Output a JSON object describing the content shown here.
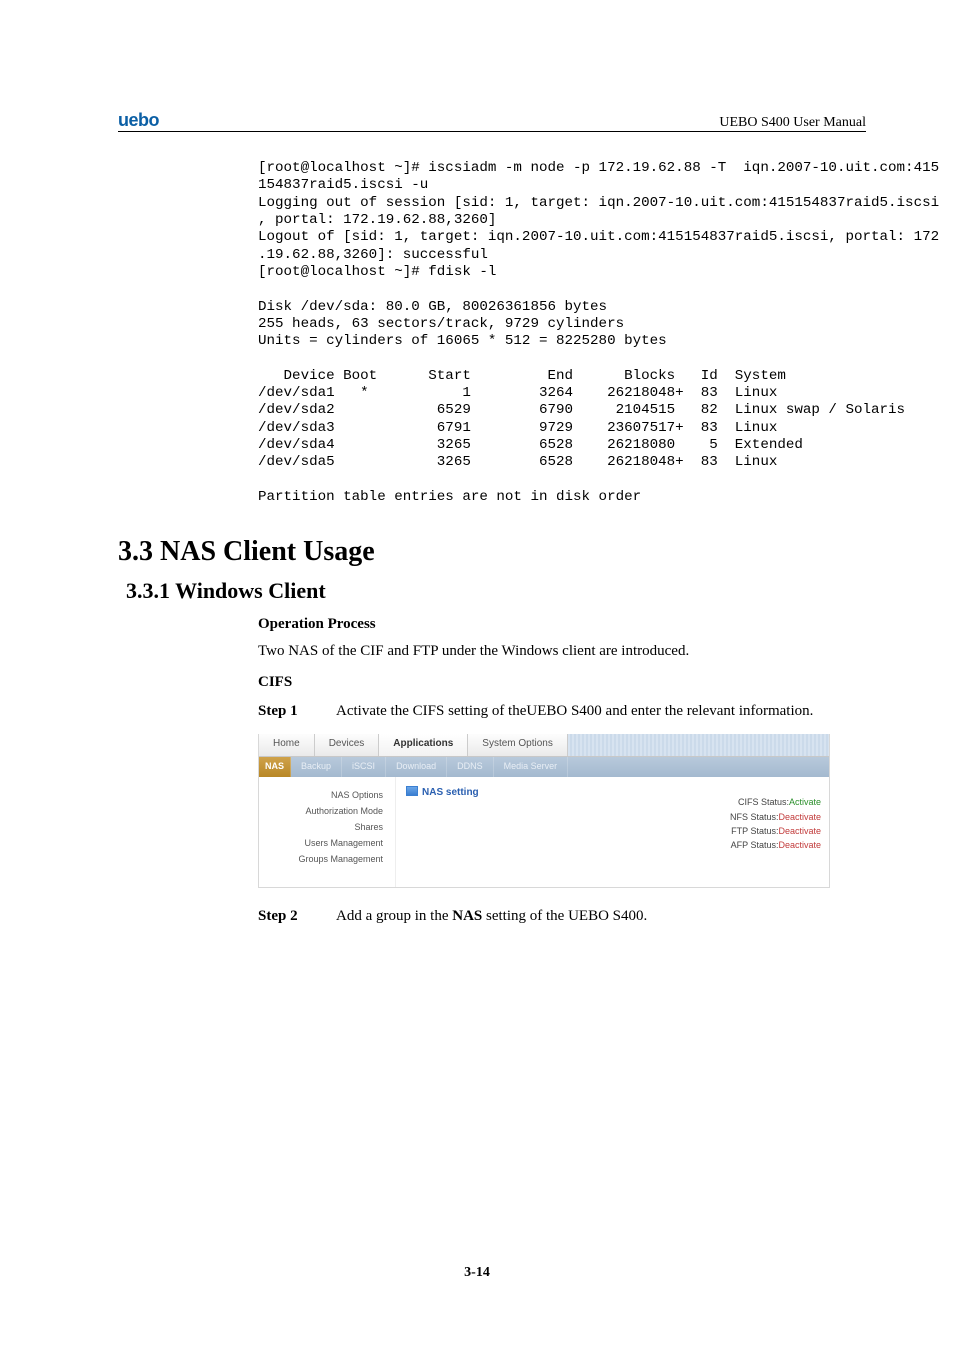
{
  "header": {
    "logo": "uebo",
    "right": "UEBO S400 User Manual"
  },
  "terminal": "[root@localhost ~]# iscsiadm -m node -p 172.19.62.88 -T  iqn.2007-10.uit.com:415\n154837raid5.iscsi -u\nLogging out of session [sid: 1, target: iqn.2007-10.uit.com:415154837raid5.iscsi\n, portal: 172.19.62.88,3260]\nLogout of [sid: 1, target: iqn.2007-10.uit.com:415154837raid5.iscsi, portal: 172\n.19.62.88,3260]: successful\n[root@localhost ~]# fdisk -l\n\nDisk /dev/sda: 80.0 GB, 80026361856 bytes\n255 heads, 63 sectors/track, 9729 cylinders\nUnits = cylinders of 16065 * 512 = 8225280 bytes\n\n   Device Boot      Start         End      Blocks   Id  System\n/dev/sda1   *           1        3264    26218048+  83  Linux\n/dev/sda2            6529        6790     2104515   82  Linux swap / Solaris\n/dev/sda3            6791        9729    23607517+  83  Linux\n/dev/sda4            3265        6528    26218080    5  Extended\n/dev/sda5            3265        6528    26218048+  83  Linux\n\nPartition table entries are not in disk order",
  "section_title": "3.3 NAS Client Usage",
  "subsection_title": "3.3.1 Windows Client",
  "op_process": "Operation Process",
  "intro": "Two NAS of the CIF and FTP under the Windows client are introduced.",
  "cifs_label": "CIFS",
  "step1": {
    "label": "Step 1",
    "text": "Activate the CIFS setting of theUEBO S400 and enter the relevant information."
  },
  "embed": {
    "tabs1": [
      "Home",
      "Devices",
      "Applications",
      "System Options"
    ],
    "tabs1_active_index": 2,
    "tabs2": [
      "NAS",
      "Backup",
      "iSCSI",
      "Download",
      "DDNS",
      "Media Server"
    ],
    "sidenav": [
      "NAS Options",
      "Authorization Mode",
      "Shares",
      "Users Management",
      "Groups Management"
    ],
    "panel_title": "NAS setting",
    "status": [
      {
        "label": "CIFS Status:",
        "value": "Activate",
        "cls": "act"
      },
      {
        "label": "NFS Status:",
        "value": "Deactivate",
        "cls": "deact"
      },
      {
        "label": "FTP Status:",
        "value": "Deactivate",
        "cls": "deact"
      },
      {
        "label": "AFP Status:",
        "value": "Deactivate",
        "cls": "deact"
      }
    ]
  },
  "step2": {
    "label": "Step 2",
    "text_pre": "Add a group in the ",
    "text_bold": "NAS",
    "text_post": " setting of the UEBO S400."
  },
  "page_number": "3-14"
}
